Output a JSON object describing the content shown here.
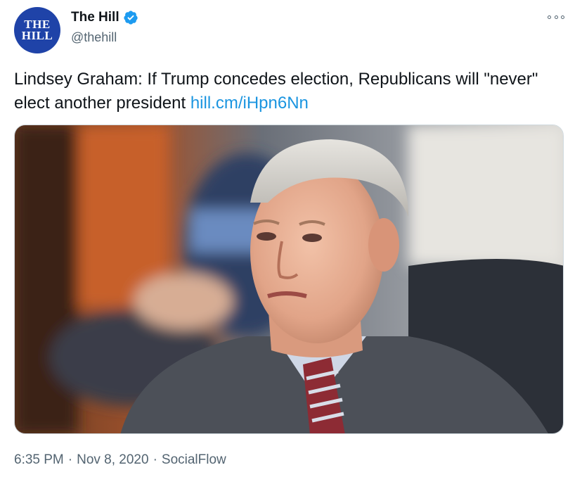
{
  "author": {
    "avatar_text": "THE\nHILL",
    "display_name": "The Hill",
    "handle": "@thehill",
    "verified": true
  },
  "tweet": {
    "text": "Lindsey Graham: If Trump concedes election, Republicans will \"never\" elect another president ",
    "link": "hill.cm/iHpn6Nn"
  },
  "meta": {
    "time": "6:35 PM",
    "separator": "·",
    "date": "Nov 8, 2020",
    "source": "SocialFlow"
  },
  "colors": {
    "link": "#1b95e0",
    "avatar_bg": "#1f43a8",
    "verified": "#1d9bf0",
    "muted": "#536471"
  }
}
